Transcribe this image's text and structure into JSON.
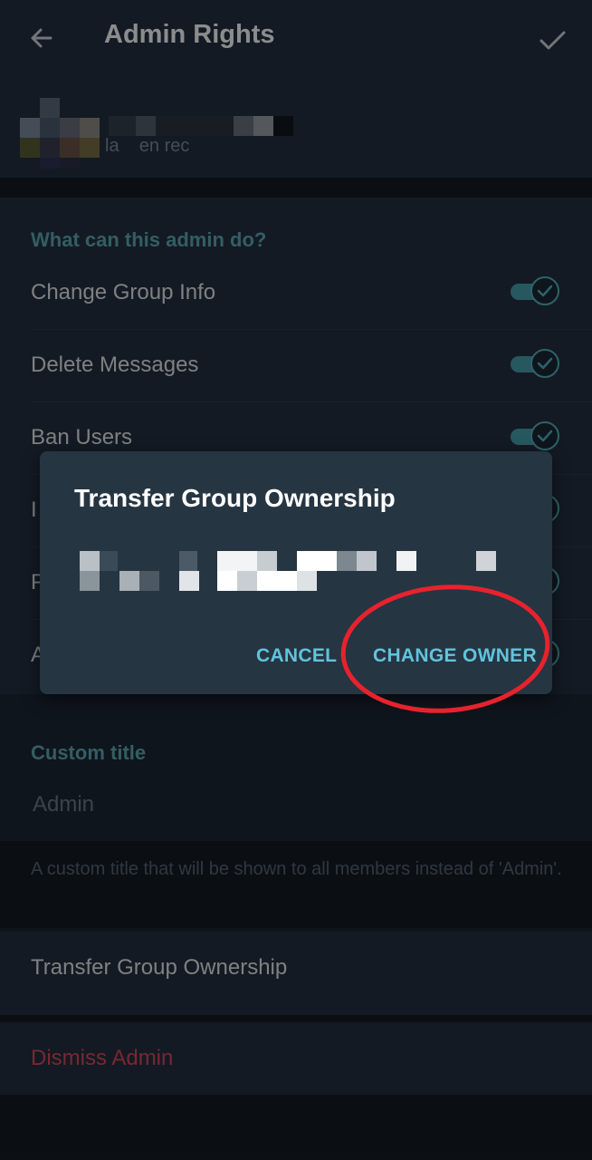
{
  "header": {
    "title": "Admin Rights",
    "back_icon": "arrow-back-icon",
    "confirm_icon": "checkmark-icon"
  },
  "user": {
    "status": "la    en rec"
  },
  "permissions": {
    "section_title": "What can this admin do?",
    "items": [
      {
        "label": "Change Group Info",
        "enabled": true
      },
      {
        "label": "Delete Messages",
        "enabled": true
      },
      {
        "label": "Ban Users",
        "enabled": true
      },
      {
        "label": "I",
        "enabled": true
      },
      {
        "label": "P",
        "enabled": true
      },
      {
        "label": "A",
        "enabled": true
      }
    ]
  },
  "custom_title": {
    "section_title": "Custom title",
    "input_value": "Admin",
    "hint": "A custom title that will be shown to all members instead of 'Admin'."
  },
  "actions": {
    "transfer_label": "Transfer Group Ownership",
    "dismiss_label": "Dismiss Admin"
  },
  "dialog": {
    "title": "Transfer Group Ownership",
    "cancel_label": "CANCEL",
    "confirm_label": "CHANGE OWNER"
  },
  "colors": {
    "accent": "#5fa9b7",
    "button_text": "#62c3dc",
    "danger": "#d94a5a",
    "annotation_red": "#e8222d"
  }
}
